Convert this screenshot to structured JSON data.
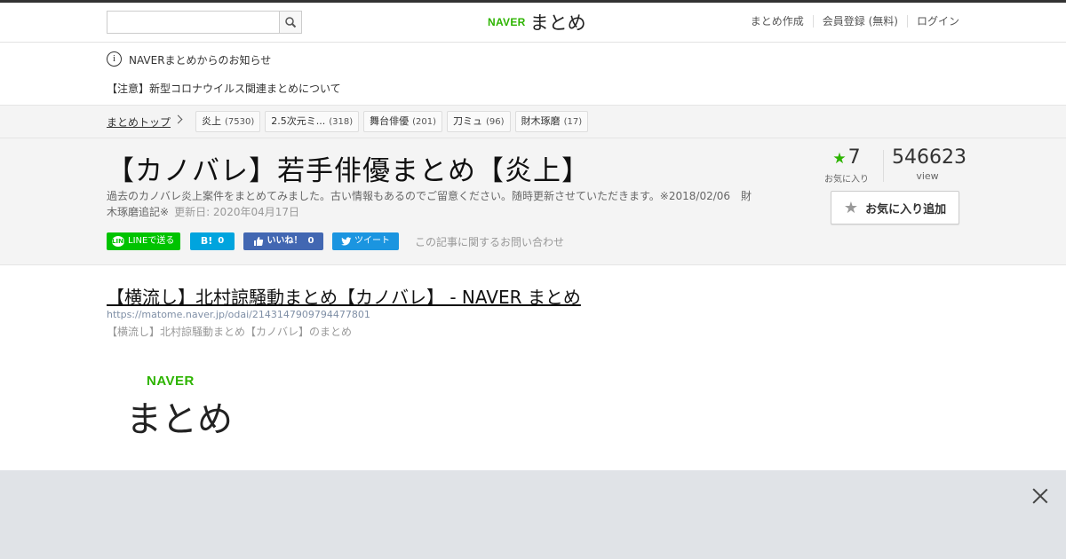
{
  "header": {
    "search_placeholder": "",
    "logo_brand": "NAVER",
    "logo_text": "まとめ",
    "nav": [
      "まとめ作成",
      "会員登録 (無料)",
      "ログイン"
    ]
  },
  "notice": {
    "title": "NAVERまとめからのお知らせ",
    "link": "【注意】新型コロナウイルス関連まとめについて"
  },
  "breadcrumb": {
    "top": "まとめトップ",
    "tags": [
      {
        "label": "炎上",
        "count": "(7530)"
      },
      {
        "label": "2.5次元ミ...",
        "count": "(318)"
      },
      {
        "label": "舞台俳優",
        "count": "(201)"
      },
      {
        "label": "刀ミュ",
        "count": "(96)"
      },
      {
        "label": "財木琢磨",
        "count": "(17)"
      }
    ]
  },
  "article": {
    "title": "【カノバレ】若手俳優まとめ【炎上】",
    "description": "過去のカノバレ炎上案件をまとめてみました。古い情報もあるのでご留意ください。随時更新させていただきます。※2018/02/06　財木琢磨追記※",
    "updated": "更新日: 2020年04月17日",
    "favorites_count": "7",
    "favorites_label": "お気に入り",
    "views": "546623",
    "views_label": "view",
    "add_favorite_label": "お気に入り追加"
  },
  "share": {
    "line_badge": "LINE",
    "line_label": "LINEで送る",
    "hatena_icon": "B!",
    "hatena_count": "0",
    "fb_label": "いいね！",
    "fb_count": "0",
    "twitter_label": "ツイート",
    "contact": "この記事に関するお問い合わせ"
  },
  "linked_article": {
    "title": "【横流し】北村諒騒動まとめ【カノバレ】 - NAVER まとめ",
    "url": "https://matome.naver.jp/odai/2143147909794477801",
    "subtitle": "【横流し】北村諒騒動まとめ【カノバレ】のまとめ",
    "thumb_brand": "NAVER",
    "thumb_text": "まとめ"
  },
  "colors": {
    "naver_green": "#2db400",
    "line_green": "#00c300",
    "hatena_blue": "#00a4de",
    "facebook_blue": "#4267b2",
    "twitter_blue": "#1b95e0"
  }
}
